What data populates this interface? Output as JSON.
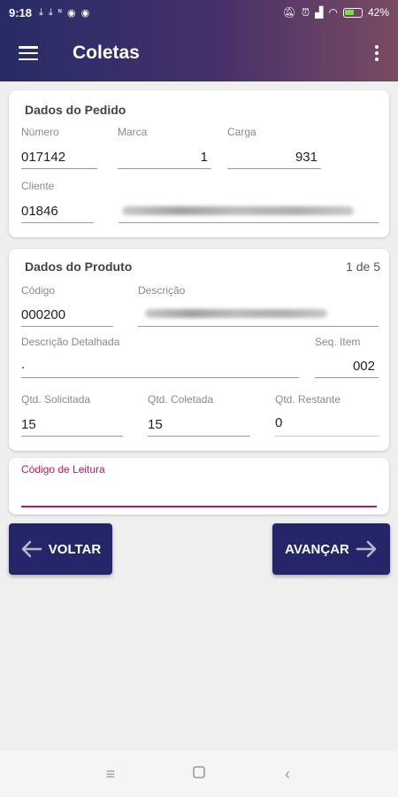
{
  "status_bar": {
    "time": "9:18",
    "battery": "42%",
    "left_icons": [
      "download-icon",
      "download-icon",
      "nfc-icon",
      "game-icon",
      "game-icon"
    ],
    "right_icons": [
      "mute-icon",
      "alarm-icon",
      "signal-icon",
      "wifi-icon",
      "battery-icon"
    ]
  },
  "app_bar": {
    "title": "Coletas"
  },
  "pedido": {
    "title": "Dados do Pedido",
    "numero": {
      "label": "Número",
      "value": "017142"
    },
    "marca": {
      "label": "Marca",
      "value": "1"
    },
    "carga": {
      "label": "Carga",
      "value": "931"
    },
    "cliente": {
      "label": "Cliente",
      "value": "01846"
    }
  },
  "produto": {
    "title": "Dados do Produto",
    "counter": "1 de 5",
    "codigo": {
      "label": "Código",
      "value": "000200"
    },
    "descricao": {
      "label": "Descrição"
    },
    "descricao_detalhada": {
      "label": "Descrição Detalhada",
      "value": "."
    },
    "seq_item": {
      "label": "Seq. Item",
      "value": "002"
    },
    "qtd_solicitada": {
      "label": "Qtd. Solicitada",
      "value": "15"
    },
    "qtd_coletada": {
      "label": "Qtd. Coletada",
      "value": "15"
    },
    "qtd_restante": {
      "label": "Qtd. Restante",
      "value": "0"
    }
  },
  "leitura": {
    "label": "Código de Leitura",
    "value": ""
  },
  "buttons": {
    "voltar": "VOLTAR",
    "avancar": "AVANÇAR"
  },
  "colors": {
    "primary": "#25266a",
    "accent": "#c2185b",
    "gradient_end": "#7a4b62"
  }
}
